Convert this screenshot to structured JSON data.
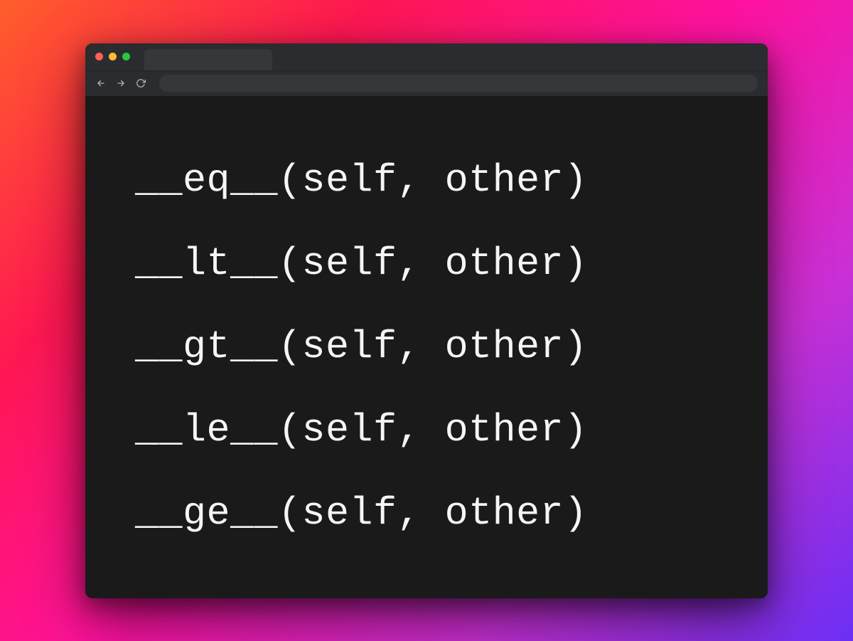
{
  "window": {
    "traffic_lights": [
      "red",
      "yellow",
      "green"
    ]
  },
  "content": {
    "lines": [
      "__eq__(self, other)",
      "__lt__(self, other)",
      "__gt__(self, other)",
      "__le__(self, other)",
      "__ge__(self, other)"
    ]
  }
}
